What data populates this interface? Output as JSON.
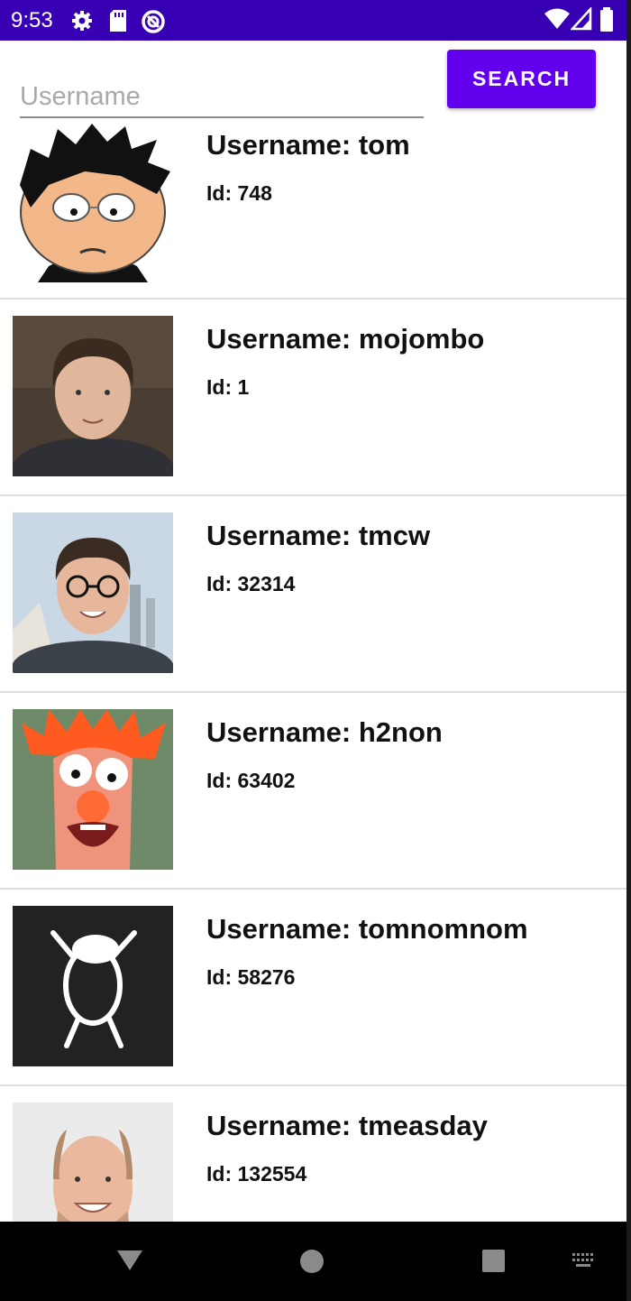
{
  "status_bar": {
    "time": "9:53"
  },
  "search": {
    "placeholder": "Username",
    "value": "",
    "button_label": "SEARCH"
  },
  "users": [
    {
      "name": "Username: tom",
      "id": "Id: 748",
      "avatar": "cartoon-avatar-icon"
    },
    {
      "name": "Username: mojombo",
      "id": "Id: 1",
      "avatar": "photo-avatar"
    },
    {
      "name": "Username: tmcw",
      "id": "Id: 32314",
      "avatar": "photo-avatar"
    },
    {
      "name": "Username: h2non",
      "id": "Id: 63402",
      "avatar": "muppet-avatar"
    },
    {
      "name": "Username: tomnomnom",
      "id": "Id: 58276",
      "avatar": "sheep-drawing-avatar"
    },
    {
      "name": "Username: tmeasday",
      "id": "Id: 132554",
      "avatar": "photo-avatar"
    }
  ],
  "colors": {
    "status_bar": "#3700b3",
    "accent": "#6200ee"
  }
}
